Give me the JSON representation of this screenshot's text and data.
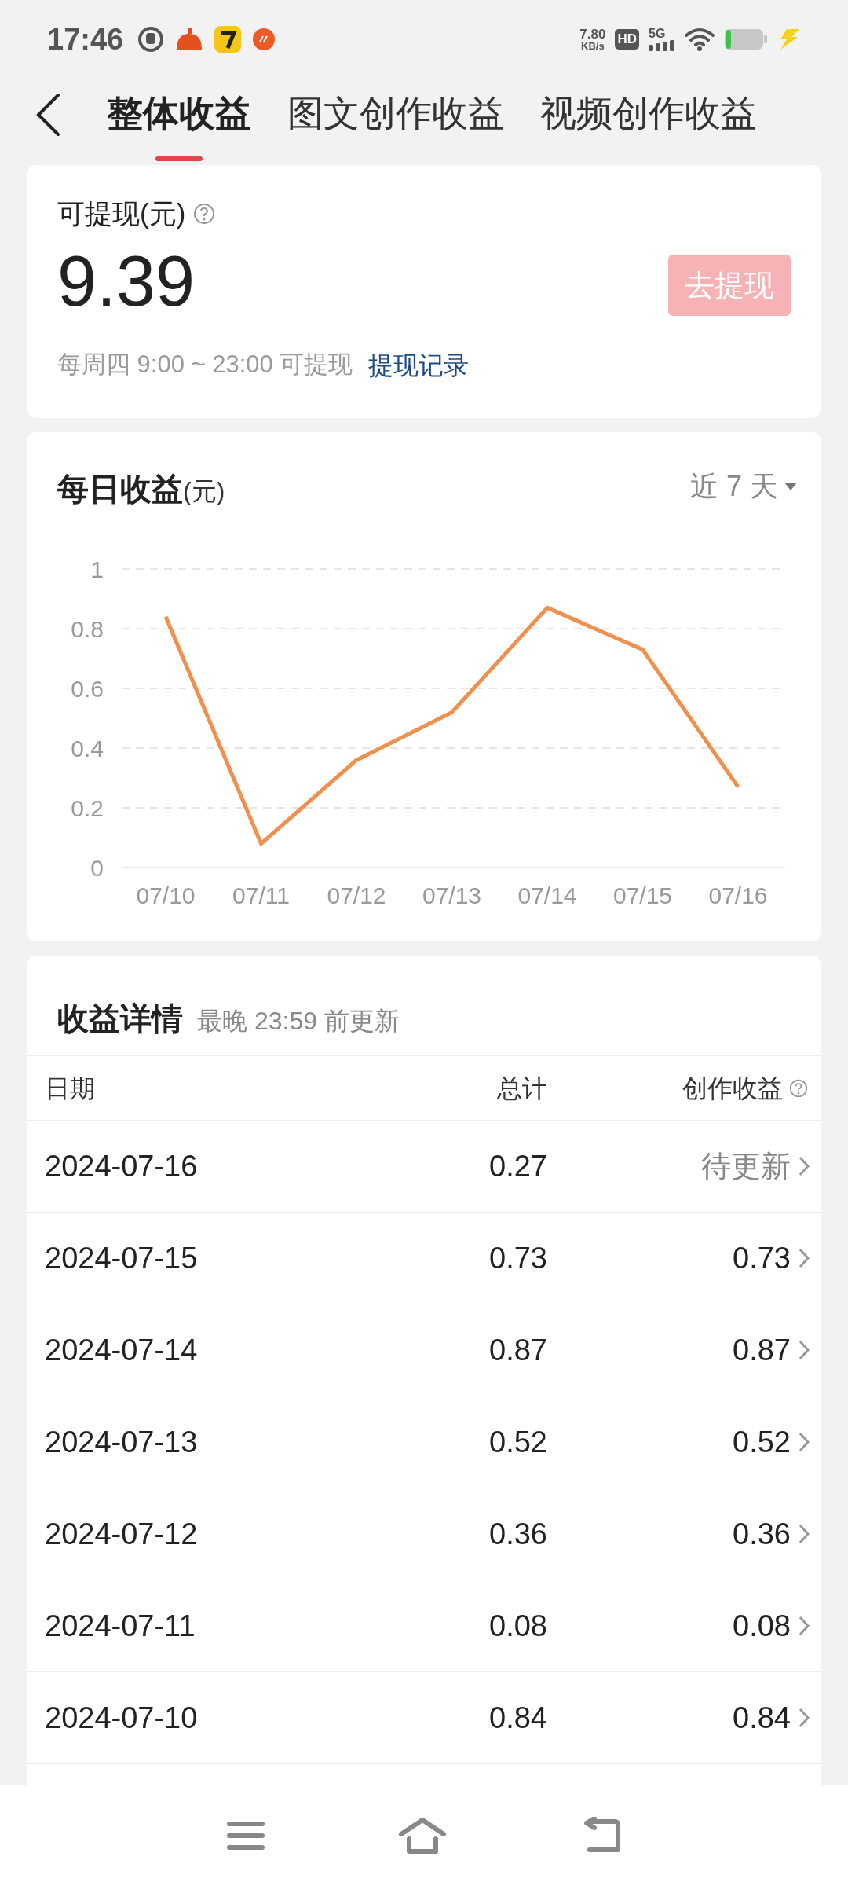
{
  "status_bar": {
    "time": "17:46",
    "speed_value": "7.80",
    "speed_unit": "KB/s",
    "hd": "HD",
    "network": "5G"
  },
  "tabs": [
    {
      "label": "整体收益",
      "selected": true
    },
    {
      "label": "图文创作收益",
      "selected": false
    },
    {
      "label": "视频创作收益",
      "selected": false
    }
  ],
  "withdraw": {
    "title": "可提现(元)",
    "amount": "9.39",
    "button": "去提现",
    "button_disabled": true,
    "note": "每周四 9:00 ~ 23:00 可提现",
    "link": "提现记录"
  },
  "daily": {
    "title": "每日收益",
    "unit": "(元)",
    "range": "近 7 天",
    "chart_data": {
      "type": "line",
      "categories": [
        "07/10",
        "07/11",
        "07/12",
        "07/13",
        "07/14",
        "07/15",
        "07/16"
      ],
      "grid": true,
      "series": [
        {
          "color": "#f0904f",
          "values": [
            0.84,
            0.08,
            0.36,
            0.52,
            0.87,
            0.73,
            0.27
          ]
        }
      ],
      "ylim": [
        0,
        1
      ],
      "yticks": [
        0,
        {
          "value": 0.2,
          "label": "0.2"
        },
        {
          "value": 0.4,
          "label": "0.4"
        },
        {
          "value": 0.6,
          "label": "0.6"
        },
        {
          "value": 0.8,
          "label": "0.8"
        },
        1
      ]
    }
  },
  "details": {
    "title": "收益详情",
    "subtitle": "最晚 23:59 前更新",
    "columns": [
      "日期",
      "总计",
      "创作收益"
    ],
    "rows": [
      {
        "date": "2024-07-16",
        "total": "0.27",
        "creation": "待更新",
        "pending": true
      },
      {
        "date": "2024-07-15",
        "total": "0.73",
        "creation": "0.73",
        "pending": false
      },
      {
        "date": "2024-07-14",
        "total": "0.87",
        "creation": "0.87",
        "pending": false
      },
      {
        "date": "2024-07-13",
        "total": "0.52",
        "creation": "0.52",
        "pending": false
      },
      {
        "date": "2024-07-12",
        "total": "0.36",
        "creation": "0.36",
        "pending": false
      },
      {
        "date": "2024-07-11",
        "total": "0.08",
        "creation": "0.08",
        "pending": false
      },
      {
        "date": "2024-07-10",
        "total": "0.84",
        "creation": "0.84",
        "pending": false
      }
    ]
  }
}
